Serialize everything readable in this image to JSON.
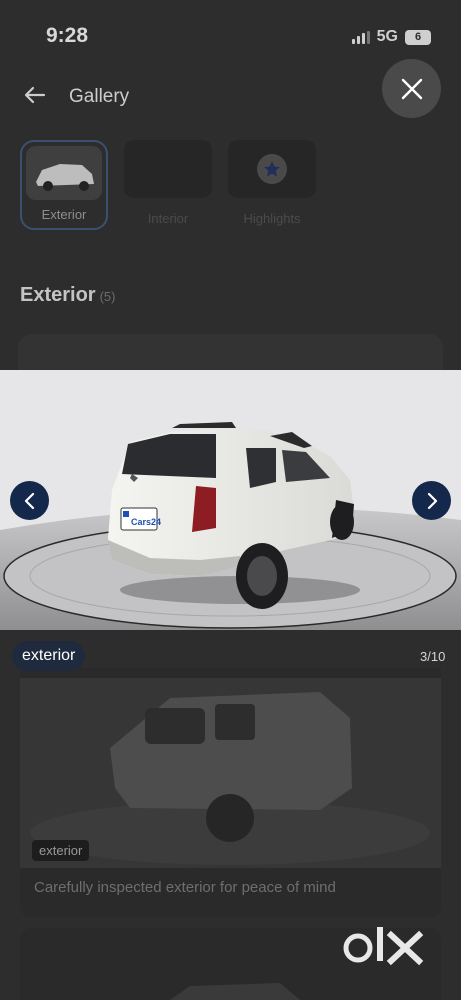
{
  "status_bar": {
    "time": "9:28",
    "network": "5G",
    "battery": "6"
  },
  "header": {
    "title": "Gallery"
  },
  "categories": [
    {
      "label": "Exterior",
      "active": true
    },
    {
      "label": "Interior",
      "active": false
    },
    {
      "label": "Highlights",
      "active": false
    }
  ],
  "section": {
    "title": "Exterior",
    "count": "(5)"
  },
  "viewer": {
    "tag": "exterior",
    "counter": "3/10",
    "plate_text": "Cars24"
  },
  "card": {
    "badge": "exterior",
    "caption": "Carefully inspected exterior for peace of mind"
  },
  "watermark": {
    "logo": "olx"
  },
  "colors": {
    "nav_button": "#14284b",
    "tag_bg": "#1f2a3e",
    "overlay_dim": "#2d2d2e"
  }
}
